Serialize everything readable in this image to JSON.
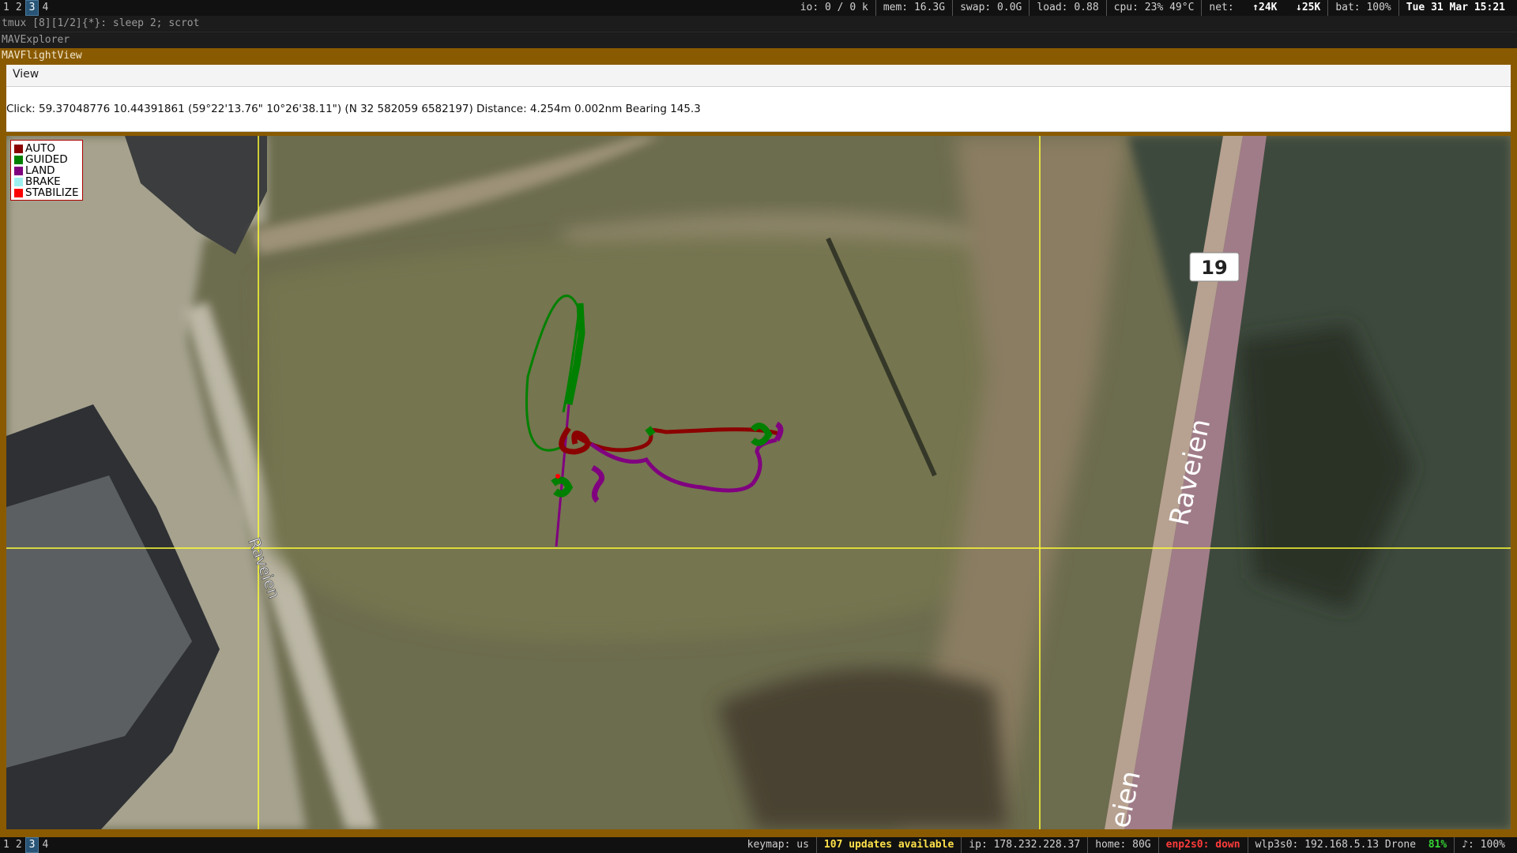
{
  "topbar": {
    "workspaces": [
      {
        "label": "1",
        "active": false
      },
      {
        "label": "2",
        "active": false
      },
      {
        "label": "3",
        "active": true
      },
      {
        "label": "4",
        "active": false
      }
    ],
    "io": "io: 0   /   0 k",
    "mem": "mem: 16.3G",
    "swap": "swap: 0.0G",
    "load": "load: 0.88",
    "cpu": "cpu:  23%   49°C",
    "net_label": "net:",
    "net_up": "↑24K",
    "net_down": "↓25K",
    "bat": "bat: 100%",
    "datetime": "Tue 31 Mar 15:21"
  },
  "tmux_title": "tmux [8][1/2]{*}:  sleep 2; scrot",
  "explorer_title": "MAVExplorer",
  "window_title": "MAVFlightView",
  "menu": {
    "view": "View"
  },
  "info": {
    "text": "Click: 59.37048776 10.44391861 (59°22'13.76\" 10°26'38.11\") (N 32 582059 6582197)  Distance: 4.254m 0.002nm Bearing 145.3"
  },
  "map": {
    "road_label_left": "Raveien",
    "road_label_right": "Raveien",
    "road_label_bottom": "eien",
    "road_number": "19",
    "colors": {
      "crosshair": "#ffff33",
      "track_auto": "#8b0000",
      "track_guided": "#008000",
      "track_land": "#800080",
      "track_stabilize": "#ff0000"
    }
  },
  "legend": {
    "items": [
      {
        "label": "AUTO",
        "color": "#8b0000"
      },
      {
        "label": "GUIDED",
        "color": "#008000"
      },
      {
        "label": "LAND",
        "color": "#800080"
      },
      {
        "label": "BRAKE",
        "color": "#9ef0f0"
      },
      {
        "label": "STABILIZE",
        "color": "#ff0000"
      }
    ]
  },
  "bottombar": {
    "workspaces": [
      {
        "label": "1",
        "active": false
      },
      {
        "label": "2",
        "active": false
      },
      {
        "label": "3",
        "active": true
      },
      {
        "label": "4",
        "active": false
      }
    ],
    "keymap": "keymap: us",
    "updates": "107 updates available",
    "ip": "ip: 178.232.228.37",
    "home": "home: 80G",
    "eth": "enp2s0: down",
    "wlan": "wlp3s0: 192.168.5.13  Drone",
    "wlan_quality": "81%",
    "volume": "♪: 100%"
  }
}
